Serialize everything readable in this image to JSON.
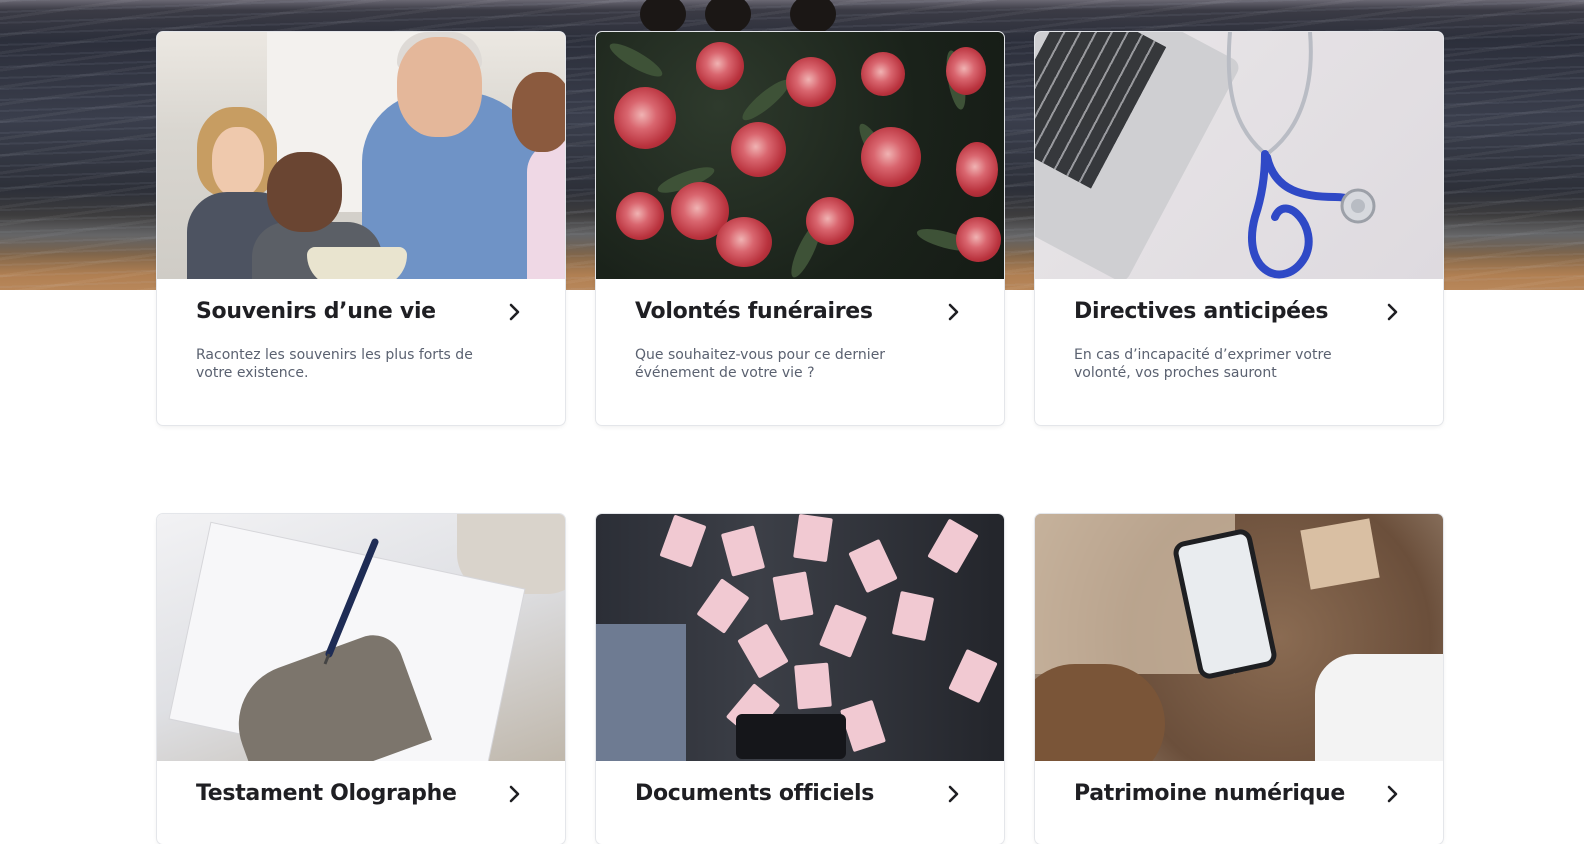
{
  "cards": [
    {
      "title": "Souvenirs d’une vie",
      "description": "Racontez les souvenirs les plus forts de votre existence.",
      "image": "family-photo",
      "icon": "chevron-right-icon"
    },
    {
      "title": "Volontés funéraires",
      "description": "Que souhaitez-vous pour ce dernier événement de votre vie ?",
      "image": "peonies-photo",
      "icon": "chevron-right-icon"
    },
    {
      "title": "Directives anticipées",
      "description": "En cas d’incapacité d’exprimer votre volonté, vos proches sauront",
      "image": "stethoscope-laptop-photo",
      "icon": "chevron-right-icon"
    },
    {
      "title": "Testament Olographe",
      "description": "",
      "image": "writing-hand-photo",
      "icon": "chevron-right-icon"
    },
    {
      "title": "Documents officiels",
      "description": "",
      "image": "flying-papers-photo",
      "icon": "chevron-right-icon"
    },
    {
      "title": "Patrimoine numérique",
      "description": "",
      "image": "smartphone-photo",
      "icon": "chevron-right-icon"
    }
  ],
  "colors": {
    "card_title": "#1f1f23",
    "card_text": "#5a6170",
    "card_border": "#e4e6ea"
  }
}
